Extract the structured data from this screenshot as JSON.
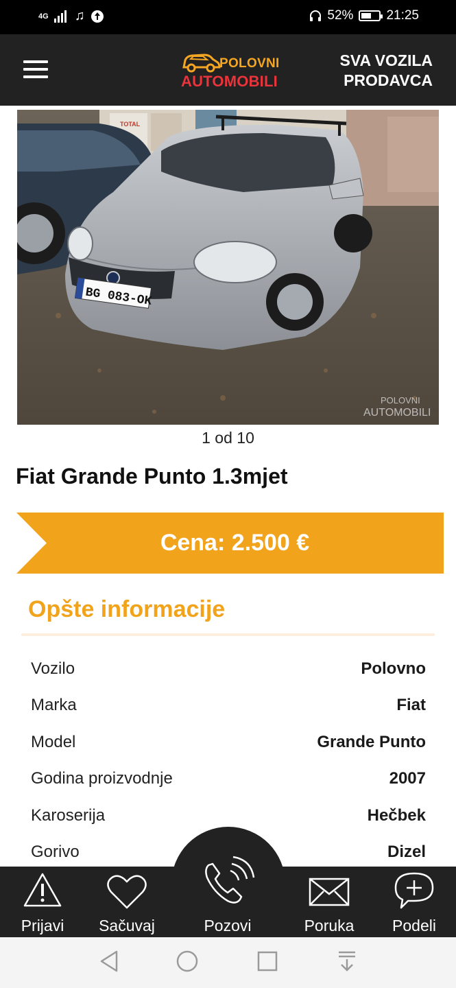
{
  "status_bar": {
    "network": "4G",
    "battery": "52%",
    "time": "21:25"
  },
  "header": {
    "logo_line1": "POLOVNI",
    "logo_line2": "AUTOMOBILI",
    "seller_line1": "SVA VOZILA",
    "seller_line2": "PRODAVCA"
  },
  "gallery": {
    "counter": "1 od 10",
    "current": 1,
    "total": 10,
    "plate": "BG 083-OK",
    "watermark_line1": "POLOVNI",
    "watermark_line2": "AUTOMOBILI",
    "sign_text": "TOTAL"
  },
  "listing": {
    "title": "Fiat Grande Punto 1.3mjet",
    "price": "Cena: 2.500 €"
  },
  "general_info": {
    "heading": "Opšte informacije",
    "rows": [
      {
        "label": "Vozilo",
        "value": "Polovno"
      },
      {
        "label": "Marka",
        "value": "Fiat"
      },
      {
        "label": "Model",
        "value": "Grande Punto"
      },
      {
        "label": "Godina proizvodnje",
        "value": "2007"
      },
      {
        "label": "Karoserija",
        "value": "Hečbek"
      },
      {
        "label": "Gorivo",
        "value": "Dizel"
      }
    ]
  },
  "actions": {
    "report": "Prijavi",
    "save": "Sačuvaj",
    "call": "Pozovi",
    "message": "Poruka",
    "share": "Podeli"
  },
  "colors": {
    "accent": "#f2a31c",
    "header_bg": "#222222",
    "logo_red": "#e8343a"
  }
}
